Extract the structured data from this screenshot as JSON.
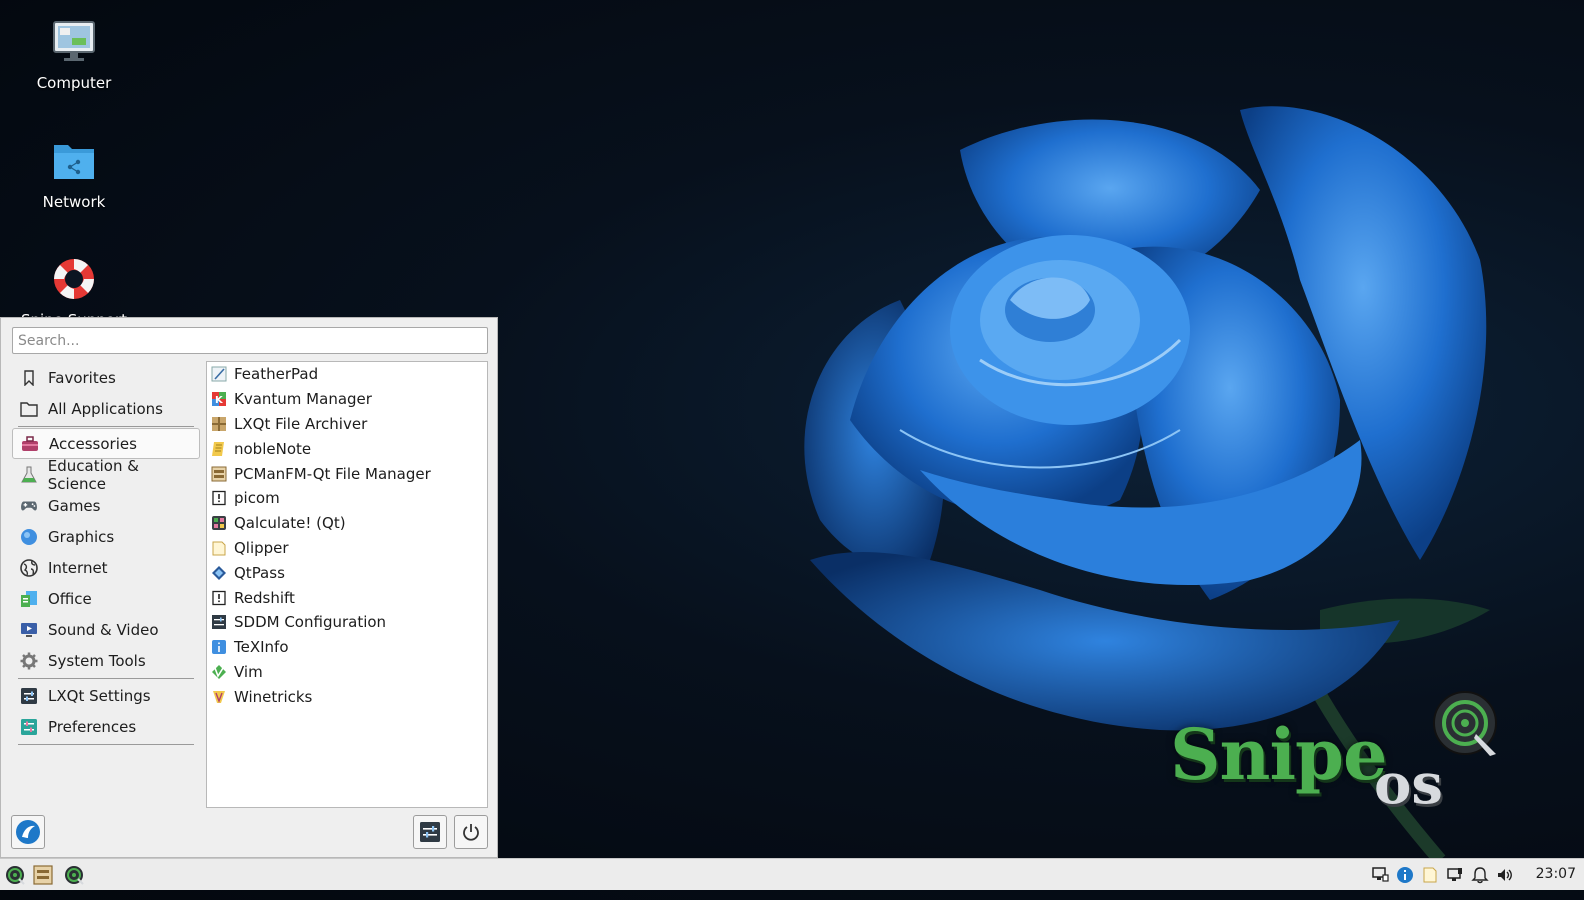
{
  "desktop": {
    "icons": [
      {
        "label": "Computer",
        "icon": "computer-icon"
      },
      {
        "label": "Network",
        "icon": "network-folder-icon"
      },
      {
        "label": "Snipe Support",
        "icon": "lifebuoy-icon"
      }
    ]
  },
  "wallpaper": {
    "brand_snipe": "Snipe",
    "brand_os": "os",
    "accent_green": "#4caf50",
    "rose_blue": "#2a78d0"
  },
  "menu": {
    "search_placeholder": "Search...",
    "categories": [
      {
        "label": "Favorites",
        "icon": "bookmark-icon"
      },
      {
        "label": "All Applications",
        "icon": "folder-icon"
      },
      {
        "label": "Accessories",
        "icon": "toolbox-icon",
        "selected": true
      },
      {
        "label": "Education & Science",
        "icon": "flask-icon"
      },
      {
        "label": "Games",
        "icon": "gamepad-icon"
      },
      {
        "label": "Graphics",
        "icon": "graphics-icon"
      },
      {
        "label": "Internet",
        "icon": "globe-icon"
      },
      {
        "label": "Office",
        "icon": "office-icon"
      },
      {
        "label": "Sound & Video",
        "icon": "media-icon"
      },
      {
        "label": "System Tools",
        "icon": "gear-icon"
      },
      {
        "label": "LXQt Settings",
        "icon": "settings-panel-icon"
      },
      {
        "label": "Preferences",
        "icon": "preferences-icon"
      }
    ],
    "apps": [
      {
        "label": "FeatherPad",
        "icon": "featherpad-icon"
      },
      {
        "label": "Kvantum Manager",
        "icon": "kvantum-icon"
      },
      {
        "label": "LXQt File Archiver",
        "icon": "archive-icon"
      },
      {
        "label": "nobleNote",
        "icon": "note-icon"
      },
      {
        "label": "PCManFM-Qt File Manager",
        "icon": "file-manager-icon"
      },
      {
        "label": "picom",
        "icon": "generic-app-icon"
      },
      {
        "label": "Qalculate! (Qt)",
        "icon": "calculator-icon"
      },
      {
        "label": "Qlipper",
        "icon": "clipboard-icon"
      },
      {
        "label": "QtPass",
        "icon": "password-icon"
      },
      {
        "label": "Redshift",
        "icon": "generic-app-icon"
      },
      {
        "label": "SDDM Configuration",
        "icon": "sddm-icon"
      },
      {
        "label": "TeXInfo",
        "icon": "info-icon"
      },
      {
        "label": "Vim",
        "icon": "vim-icon"
      },
      {
        "label": "Winetricks",
        "icon": "wine-icon"
      }
    ]
  },
  "taskbar": {
    "clock": "23:07"
  }
}
